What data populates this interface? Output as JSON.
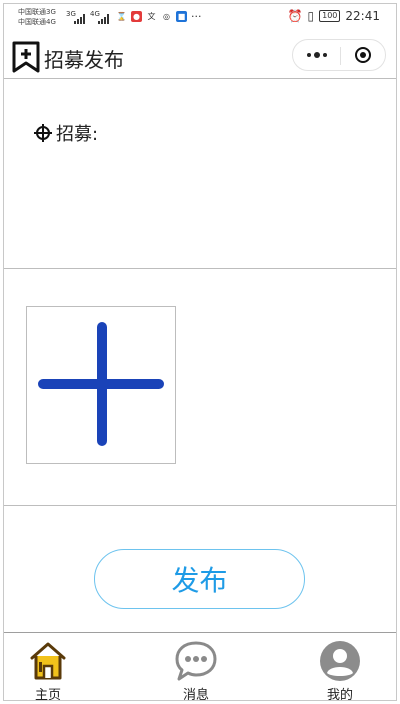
{
  "statusbar": {
    "carrier1": "中国联通3G",
    "carrier2": "中国联通4G",
    "signal1": "3G",
    "signal2": "4G",
    "battery": "100",
    "time": "22:41",
    "more": "···"
  },
  "header": {
    "title": "招募发布"
  },
  "form": {
    "recruit_label": "招募:"
  },
  "actions": {
    "publish_label": "发布"
  },
  "tabs": [
    {
      "label": "主页",
      "icon": "home-icon"
    },
    {
      "label": "消息",
      "icon": "chat-icon"
    },
    {
      "label": "我的",
      "icon": "user-icon"
    }
  ],
  "colors": {
    "accent": "#1e9be6",
    "plus": "#1a43b8",
    "home_icon": "#f2c21b"
  }
}
